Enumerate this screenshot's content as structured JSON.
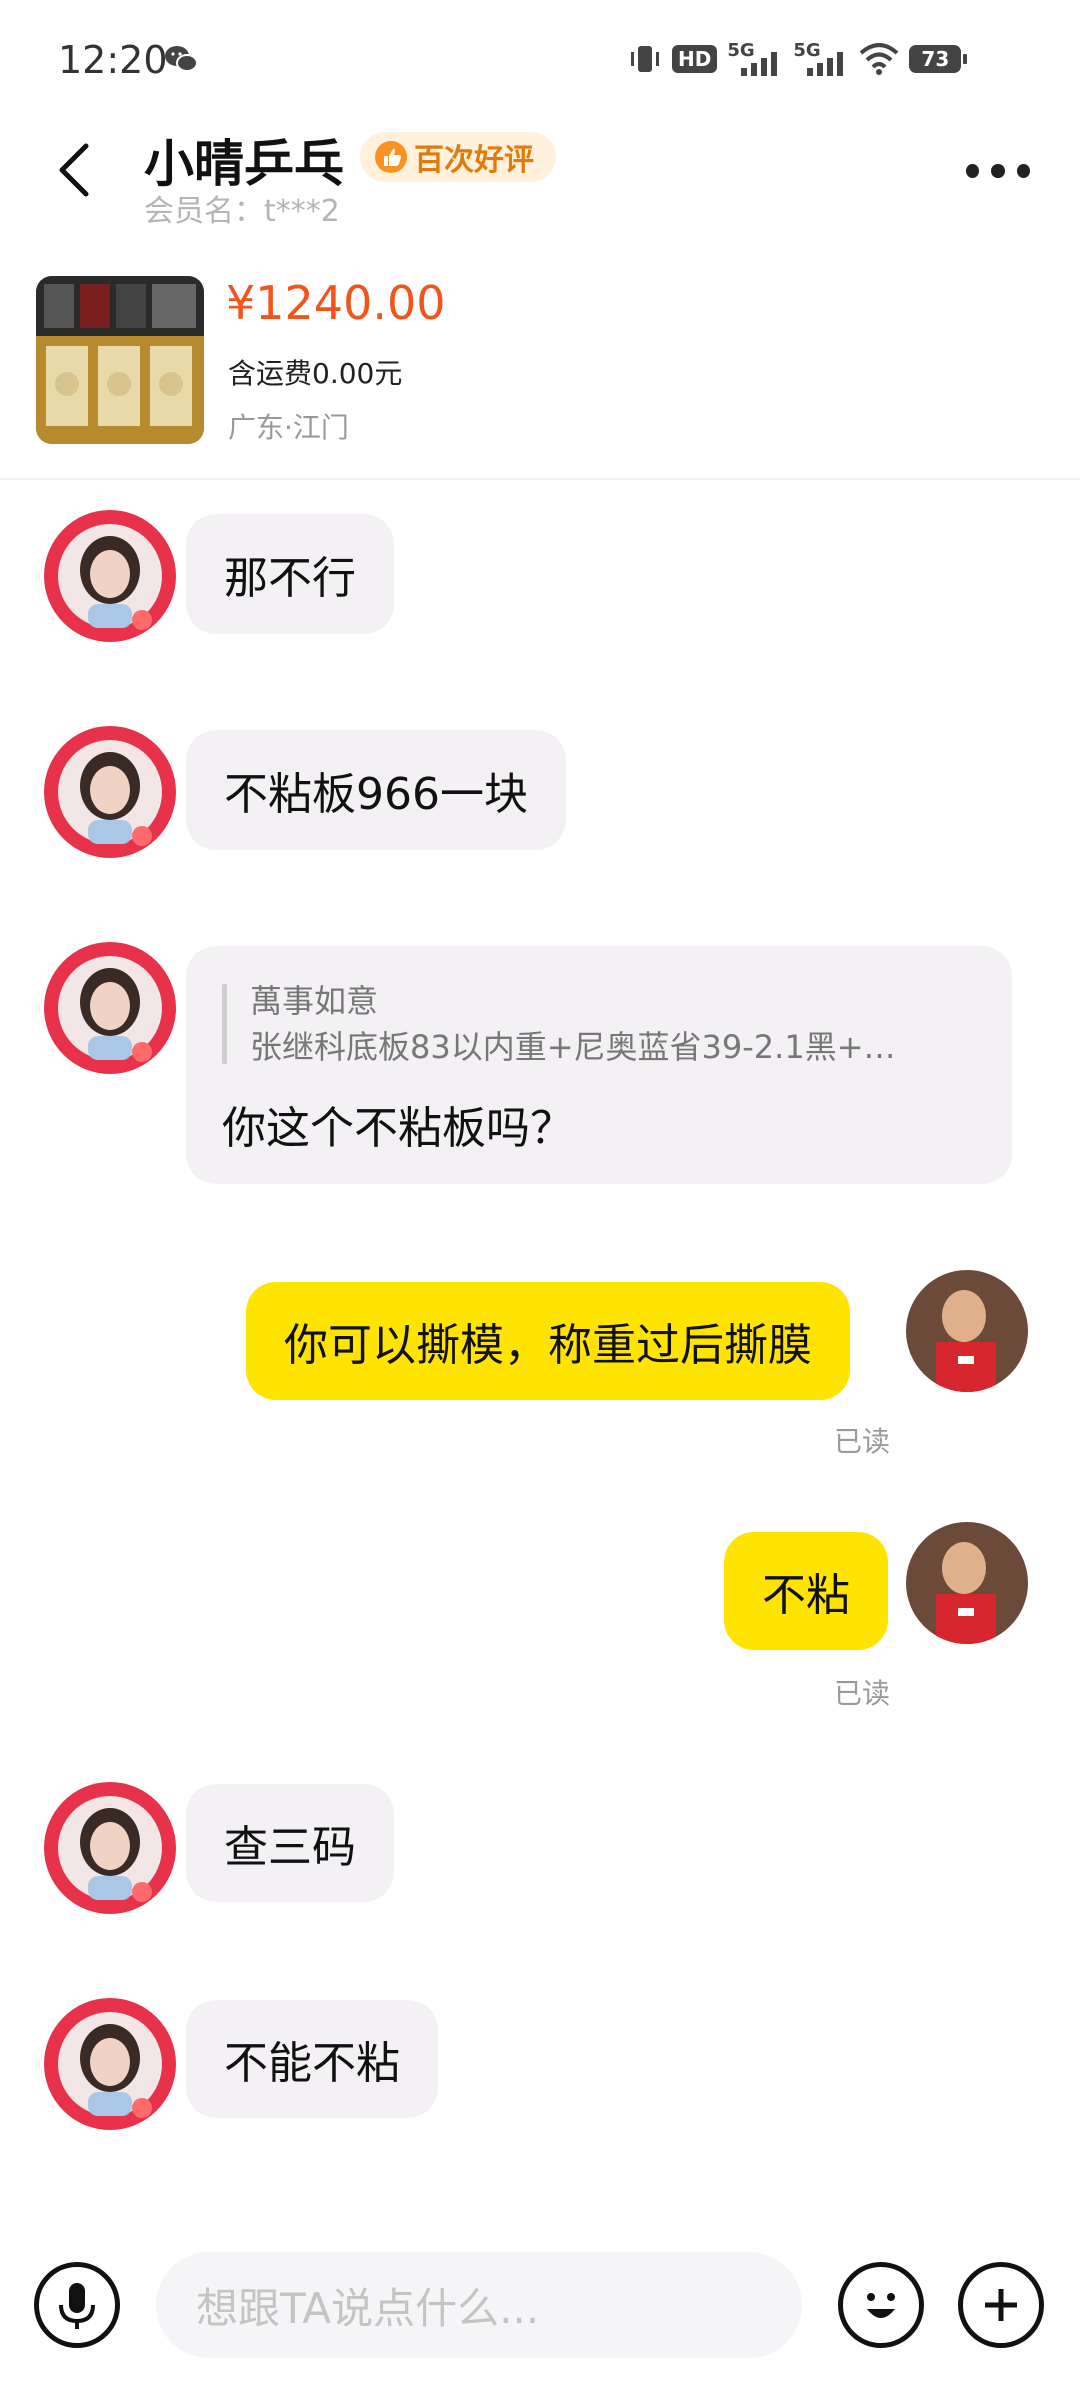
{
  "status_bar": {
    "time": "12:20",
    "battery": "73",
    "network_1": "5G",
    "network_2": "5G",
    "hd_label": "HD"
  },
  "header": {
    "title": "小晴乒乓",
    "badge": "百次好评",
    "member": "会员名：t***2"
  },
  "product": {
    "price": "¥1240.00",
    "shipping": "含运费0.00元",
    "location": "广东·江门"
  },
  "messages": [
    {
      "side": "in",
      "text": "那不行"
    },
    {
      "side": "in",
      "text": "不粘板966一块"
    },
    {
      "side": "in",
      "quote_author": "萬事如意",
      "quote_text": "张继科底板83以内重+尼奥蓝省39-2.1黑+…",
      "text": "你这个不粘板吗？"
    },
    {
      "side": "out",
      "text": "你可以撕模，称重过后撕膜",
      "status": "已读"
    },
    {
      "side": "out",
      "text": "不粘",
      "status": "已读"
    },
    {
      "side": "in",
      "text": "查三码"
    },
    {
      "side": "in",
      "text": "不能不粘"
    }
  ],
  "input": {
    "placeholder": "想跟TA说点什么..."
  },
  "colors": {
    "accent_yellow": "#ffe400",
    "price_orange": "#f2541b",
    "badge_orange": "#e07b0c",
    "incoming_bubble": "#f4f1f5"
  }
}
